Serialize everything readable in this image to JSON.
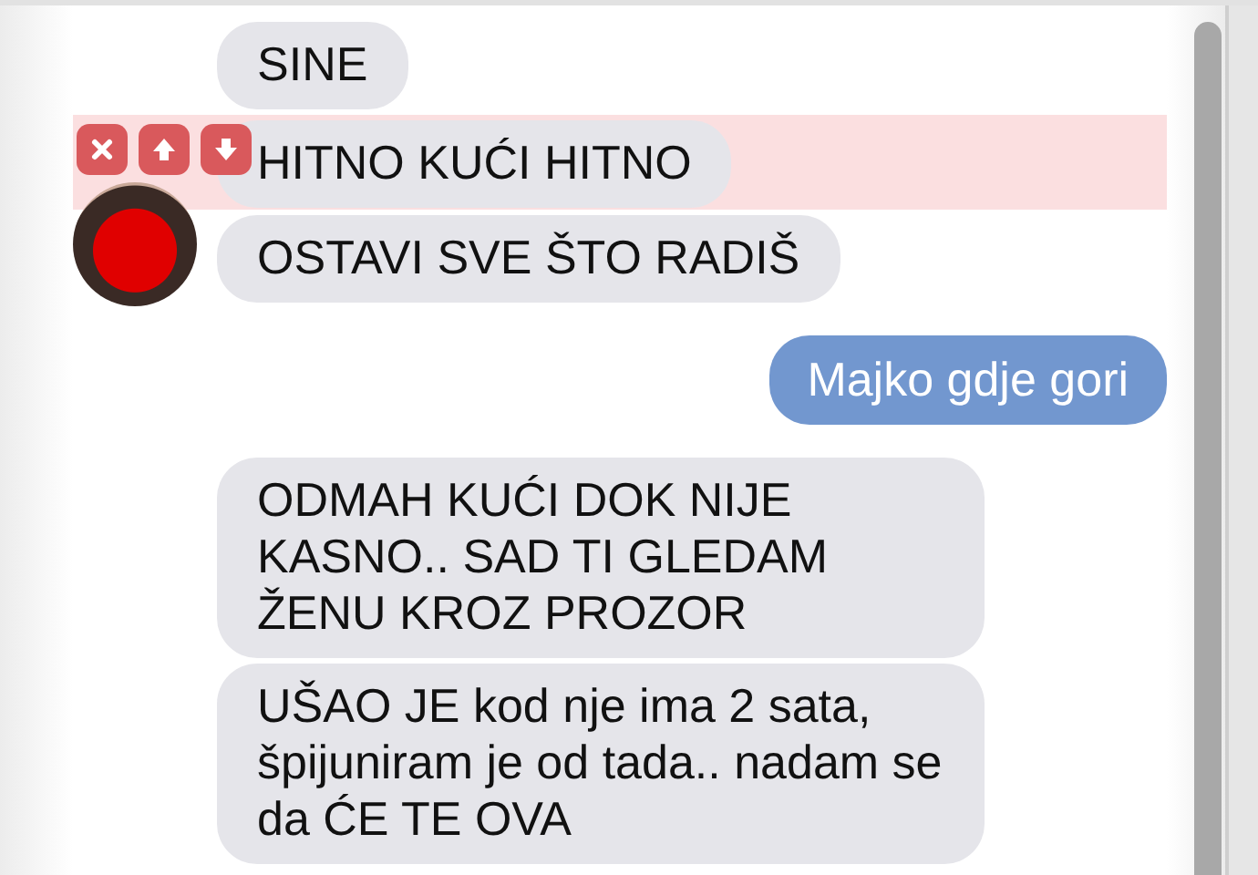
{
  "messages": [
    {
      "kind": "incoming",
      "text": "SINE",
      "selected": false,
      "avatar": false
    },
    {
      "kind": "incoming",
      "text": "HITNO KUĆI HITNO",
      "selected": true,
      "avatar": false
    },
    {
      "kind": "incoming",
      "text": "OSTAVI SVE ŠTO RADIŠ",
      "selected": false,
      "avatar": true
    },
    {
      "kind": "outgoing",
      "text": "Majko gdje gori",
      "selected": false,
      "avatar": false
    },
    {
      "kind": "incoming",
      "text": "ODMAH KUĆI DOK NIJE KASNO.. SAD TI GLEDAM ŽENU KROZ PROZOR",
      "selected": false,
      "avatar": false
    },
    {
      "kind": "incoming",
      "text": "UŠAO JE kod nje ima 2 sata, špijuniram je od tada.. nadam se da ĆE TE OVA",
      "selected": false,
      "avatar": false
    }
  ]
}
